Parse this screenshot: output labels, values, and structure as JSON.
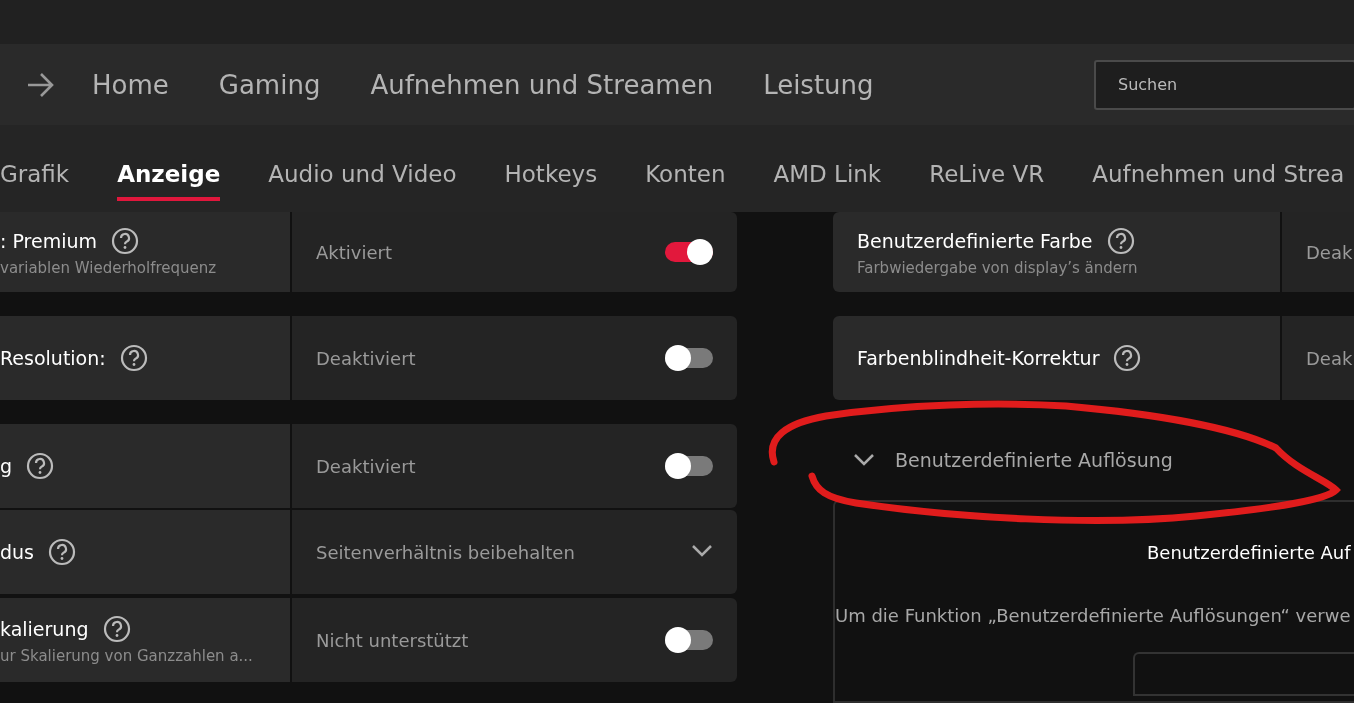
{
  "nav": {
    "items": [
      {
        "label": "Home",
        "selected": false
      },
      {
        "label": "Gaming",
        "selected": false
      },
      {
        "label": "Aufnehmen und Streamen",
        "selected": false
      },
      {
        "label": "Leistung",
        "selected": false
      }
    ],
    "search": {
      "placeholder": "Suchen"
    }
  },
  "tabs": [
    {
      "label": "Grafik",
      "selected": false
    },
    {
      "label": "Anzeige",
      "selected": true
    },
    {
      "label": "Audio und Video",
      "selected": false
    },
    {
      "label": "Hotkeys",
      "selected": false
    },
    {
      "label": "Konten",
      "selected": false
    },
    {
      "label": "AMD Link",
      "selected": false
    },
    {
      "label": "ReLive VR",
      "selected": false
    },
    {
      "label": "Aufnehmen und Strea",
      "selected": false
    }
  ],
  "left_settings": [
    {
      "label": ": Premium",
      "subtitle": "variablen Wiederholfrequenz",
      "value": "Aktiviert",
      "kind": "toggle",
      "on": true
    },
    {
      "label": "Resolution:",
      "value": "Deaktiviert",
      "kind": "toggle",
      "on": false
    },
    {
      "label": "g",
      "value": "Deaktiviert",
      "kind": "toggle",
      "on": false
    },
    {
      "label": "dus",
      "value": "Seitenverhältnis beibehalten",
      "kind": "dropdown"
    },
    {
      "label": "kalierung",
      "subtitle": "ur Skalierung von Ganzzahlen a...",
      "value": "Nicht unterstützt",
      "kind": "toggle",
      "on": false
    }
  ],
  "right_settings": [
    {
      "label": "Benutzerdefinierte Farbe",
      "subtitle": "Farbwiedergabe von display’s ändern",
      "value": "Deak"
    },
    {
      "label": "Farbenblindheit-Korrektur",
      "value": "Deak"
    }
  ],
  "section": {
    "title": "Benutzerdefinierte Auflösung",
    "expanded": true
  },
  "panel": {
    "title": "Benutzerdefinierte Auf",
    "text": "Um die Funktion „Benutzerdefinierte Auflösungen“ verwe"
  }
}
